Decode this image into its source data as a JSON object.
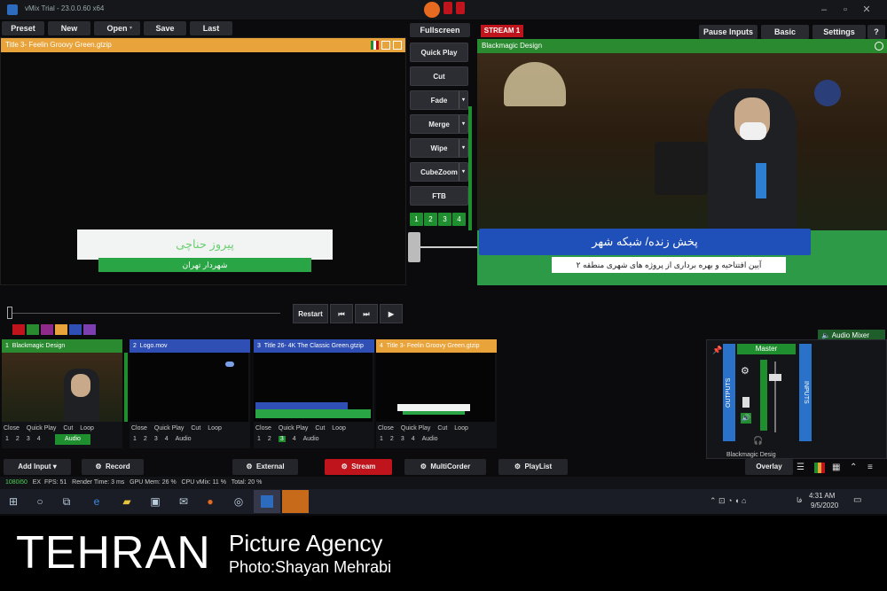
{
  "window": {
    "title": "vMix Trial - 23.0.0.60 x64"
  },
  "menu": {
    "preset": "Preset",
    "new": "New",
    "open": "Open",
    "save": "Save",
    "last": "Last"
  },
  "top_right": {
    "fullscreen": "Fullscreen",
    "stream1": "STREAM 1",
    "pause_inputs": "Pause Inputs",
    "basic": "Basic",
    "settings": "Settings",
    "help": "?"
  },
  "preview": {
    "title": "Title 3- Feelin Groovy Green.gtzip",
    "name": "پیروز حناچی",
    "role": "شهردار تهران"
  },
  "output": {
    "source": "Blackmagic Design",
    "banner_main": "پخش زنده/ شبکه شهر",
    "banner_sub": "آیین افتتاحیه و بهره برداری از پروژه های شهری منطقه ۲"
  },
  "transitions": {
    "quick_play": "Quick Play",
    "cut": "Cut",
    "fade": "Fade",
    "merge": "Merge",
    "wipe": "Wipe",
    "cubezoom": "CubeZoom",
    "ftb": "FTB",
    "nums": [
      "1",
      "2",
      "3",
      "4"
    ]
  },
  "playback": {
    "restart": "Restart"
  },
  "inputs": [
    {
      "num": "1",
      "title": "Blackmagic Design",
      "color": "#2a8a2f"
    },
    {
      "num": "2",
      "title": "Logo.mov",
      "color": "#2f4fb5"
    },
    {
      "num": "3",
      "title": "Title 26- 4K The Classic Green.gtzip",
      "color": "#2f4fb5"
    },
    {
      "num": "4",
      "title": "Title 3- Feelin Groovy Green.gtzip",
      "color": "#e8a33a"
    }
  ],
  "tile_controls": {
    "close": "Close",
    "quick_play": "Quick Play",
    "cut": "Cut",
    "loop": "Loop",
    "audio": "Audio"
  },
  "audio_mixer": {
    "title": "Audio Mixer",
    "master": "Master",
    "outputs": "OUTPUTS",
    "inputs": "INPUTS",
    "device": "Blackmagic Desig"
  },
  "bottom": {
    "add_input": "Add Input",
    "record": "Record",
    "external": "External",
    "stream": "Stream",
    "multicorder": "MultiCorder",
    "playlist": "PlayList",
    "overlay": "Overlay"
  },
  "status": {
    "res": "1080i50",
    "ex": "EX",
    "fps_label": "FPS:",
    "fps": "51",
    "render_label": "Render Time:",
    "render": "3 ms",
    "gpu_label": "GPU Mem:",
    "gpu": "26 %",
    "cpu_label": "CPU vMix:",
    "cpu": "11 %",
    "total_label": "Total:",
    "total": "20 %"
  },
  "taskbar": {
    "time": "4:31 AM",
    "date": "9/5/2020"
  },
  "brand": {
    "name": "TEHRAN",
    "agency": "Picture Agency",
    "credit": "Photo:Shayan Mehrabi"
  },
  "colors": {
    "accent_green": "#1f8e2f",
    "orange": "#e8a33a",
    "blue": "#2f4fb5",
    "red": "#c0141c"
  }
}
